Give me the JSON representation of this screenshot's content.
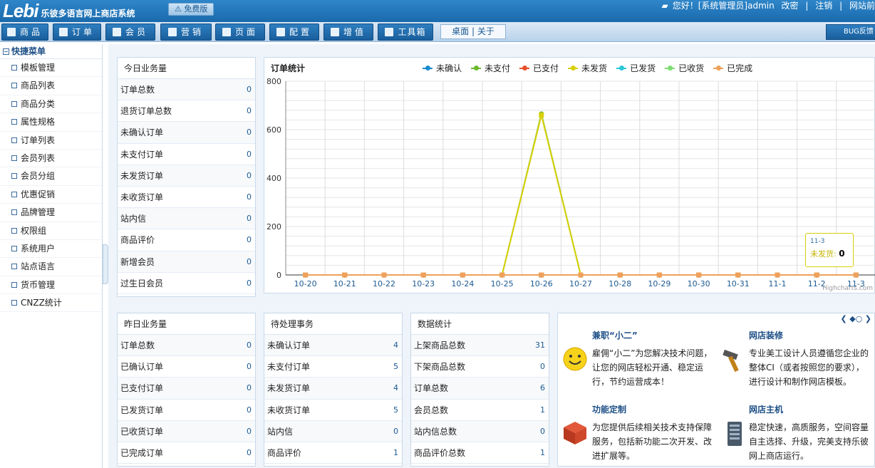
{
  "header": {
    "logo": "Lebi",
    "app_name": "乐彼多语言网上商店系统",
    "edition_badge": "免费版",
    "greeting": "您好！[系统管理员]admin",
    "change_password": "改密",
    "logout": "注销",
    "site_front": "网站前"
  },
  "nav": {
    "items": [
      "商品",
      "订单",
      "会员",
      "营销",
      "页面",
      "配置",
      "增值",
      "工具箱"
    ],
    "desk": "桌面",
    "about": "关于",
    "bug": "BUG反馈"
  },
  "sidebar": {
    "title": "快捷菜单",
    "items": [
      "模板管理",
      "商品列表",
      "商品分类",
      "属性规格",
      "订单列表",
      "会员列表",
      "会员分组",
      "优惠促销",
      "品牌管理",
      "权限组",
      "系统用户",
      "站点语言",
      "货币管理",
      "CNZZ统计"
    ]
  },
  "today": {
    "title": "今日业务量",
    "rows": [
      {
        "label": "订单总数",
        "value": "0"
      },
      {
        "label": "退货订单总数",
        "value": "0"
      },
      {
        "label": "未确认订单",
        "value": "0"
      },
      {
        "label": "未支付订单",
        "value": "0"
      },
      {
        "label": "未发货订单",
        "value": "0"
      },
      {
        "label": "未收货订单",
        "value": "0"
      },
      {
        "label": "站内信",
        "value": "0"
      },
      {
        "label": "商品评价",
        "value": "0"
      },
      {
        "label": "新增会员",
        "value": "0"
      },
      {
        "label": "过生日会员",
        "value": "0"
      }
    ]
  },
  "yesterday": {
    "title": "昨日业务量",
    "rows": [
      {
        "label": "订单总数",
        "value": "0"
      },
      {
        "label": "已确认订单",
        "value": "0"
      },
      {
        "label": "已支付订单",
        "value": "0"
      },
      {
        "label": "已发货订单",
        "value": "0"
      },
      {
        "label": "已收货订单",
        "value": "0"
      },
      {
        "label": "已完成订单",
        "value": "0"
      }
    ]
  },
  "pending": {
    "title": "待处理事务",
    "rows": [
      {
        "label": "未确认订单",
        "value": "4"
      },
      {
        "label": "未支付订单",
        "value": "5"
      },
      {
        "label": "未发货订单",
        "value": "4"
      },
      {
        "label": "未收货订单",
        "value": "5"
      },
      {
        "label": "站内信",
        "value": "0"
      },
      {
        "label": "商品评价",
        "value": "1"
      }
    ]
  },
  "stats": {
    "title": "数据统计",
    "rows": [
      {
        "label": "上架商品总数",
        "value": "31"
      },
      {
        "label": "下架商品总数",
        "value": "0"
      },
      {
        "label": "订单总数",
        "value": "6"
      },
      {
        "label": "会员总数",
        "value": "1"
      },
      {
        "label": "站内信总数",
        "value": "0"
      },
      {
        "label": "商品评价总数",
        "value": "1"
      }
    ]
  },
  "chart_data": {
    "type": "line",
    "title": "订单统计",
    "categories": [
      "10-20",
      "10-21",
      "10-22",
      "10-23",
      "10-24",
      "10-25",
      "10-26",
      "10-27",
      "10-28",
      "10-29",
      "10-30",
      "10-31",
      "11-1",
      "11-2",
      "11-3"
    ],
    "ylim": [
      0,
      800
    ],
    "yticks": [
      0,
      200,
      400,
      600,
      800
    ],
    "grid": true,
    "legend_position": "top",
    "series": [
      {
        "name": "未确认",
        "color": "#1a8bd0",
        "values": [
          0,
          0,
          0,
          0,
          0,
          0,
          0,
          0,
          0,
          0,
          0,
          0,
          0,
          0,
          0
        ]
      },
      {
        "name": "未支付",
        "color": "#6ab82b",
        "values": [
          0,
          0,
          0,
          0,
          0,
          0,
          665,
          0,
          0,
          0,
          0,
          0,
          0,
          0,
          0
        ]
      },
      {
        "name": "已支付",
        "color": "#e8502a",
        "values": [
          0,
          0,
          0,
          0,
          0,
          0,
          0,
          0,
          0,
          0,
          0,
          0,
          0,
          0,
          0
        ]
      },
      {
        "name": "未发货",
        "color": "#d8d00a",
        "values": [
          0,
          0,
          0,
          0,
          0,
          0,
          660,
          0,
          0,
          0,
          0,
          0,
          0,
          0,
          0
        ]
      },
      {
        "name": "已发货",
        "color": "#2bc7d8",
        "values": [
          0,
          0,
          0,
          0,
          0,
          0,
          0,
          0,
          0,
          0,
          0,
          0,
          0,
          0,
          0
        ]
      },
      {
        "name": "已收货",
        "color": "#7edd72",
        "values": [
          0,
          0,
          0,
          0,
          0,
          0,
          0,
          0,
          0,
          0,
          0,
          0,
          0,
          0,
          0
        ]
      },
      {
        "name": "已完成",
        "color": "#f0a05a",
        "values": [
          0,
          0,
          0,
          0,
          0,
          0,
          0,
          0,
          0,
          0,
          0,
          0,
          0,
          0,
          0
        ]
      }
    ],
    "tooltip": {
      "date": "11-3",
      "series": "未发货",
      "value": "0"
    },
    "credit": "Highcharts.com"
  },
  "promo": {
    "items": [
      {
        "title": "兼职“小二”",
        "desc": "雇佣“小二”为您解决技术问题，让您的网店轻松开通、稳定运行，节约运营成本！",
        "icon": "smiley-icon"
      },
      {
        "title": "网店装修",
        "desc": "专业美工设计人员遵循您企业的整体CI（或者按照您的要求），进行设计和制作网店模板。",
        "icon": "hammer-icon"
      },
      {
        "title": "功能定制",
        "desc": "为您提供后续相关技术支持保障服务，包括新功能二次开发、改进扩展等。",
        "icon": "cube-icon"
      },
      {
        "title": "网店主机",
        "desc": "稳定快速，高质服务，空间容量自主选择、升级，完美支持乐彼网上商店运行。",
        "icon": "server-icon"
      }
    ]
  }
}
